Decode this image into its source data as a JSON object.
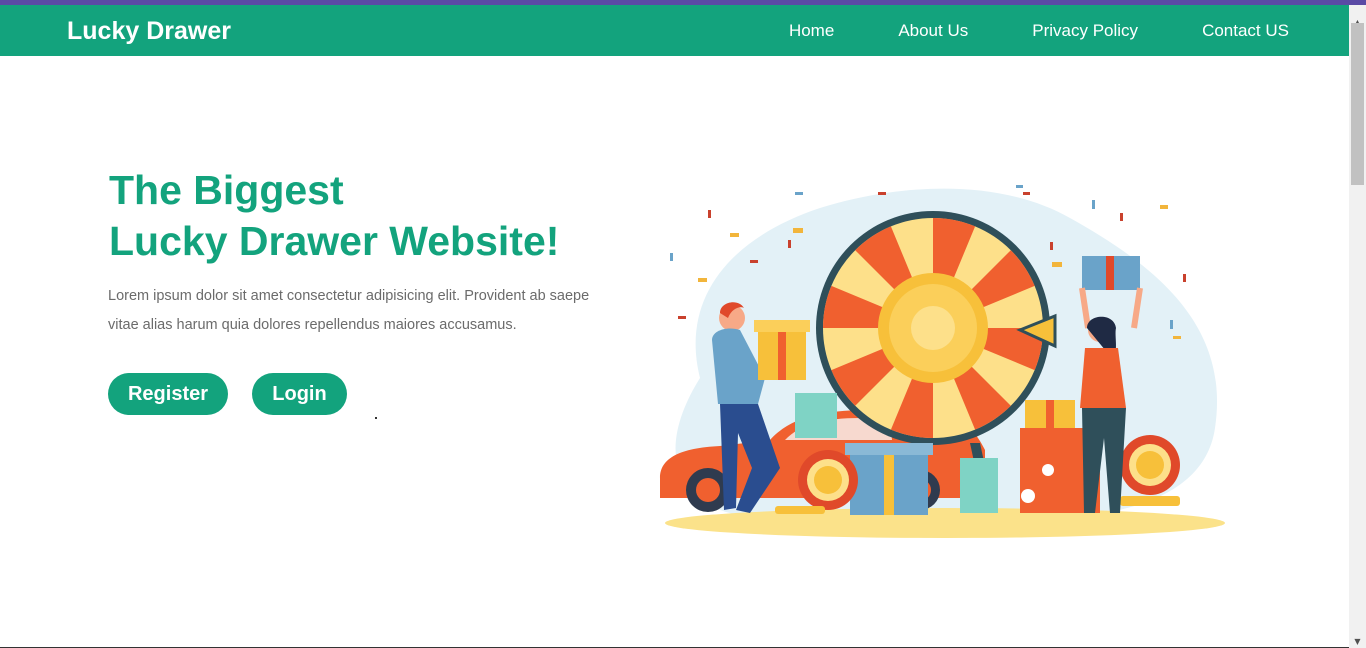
{
  "brand": "Lucky Drawer",
  "nav": {
    "items": [
      "Home",
      "About Us",
      "Privacy Policy",
      "Contact US"
    ]
  },
  "hero": {
    "title_line1": "The Biggest",
    "title_line2": "Lucky Drawer Website!",
    "description": "Lorem ipsum dolor sit amet consectetur adipisicing elit. Provident ab saepe vitae alias harum quia dolores repellendus maiores accusamus.",
    "register_label": "Register",
    "login_label": "Login"
  },
  "colors": {
    "brand_green": "#13a37d",
    "top_accent": "#5a4aa5",
    "text_gray": "#6b6b6b"
  },
  "illustration": {
    "name": "lucky-wheel-illustration"
  }
}
